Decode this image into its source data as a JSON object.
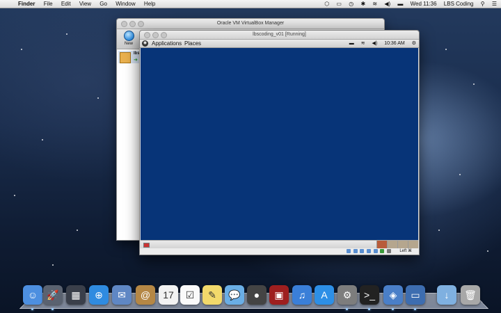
{
  "menubar": {
    "app_name": "Finder",
    "menus": [
      "File",
      "Edit",
      "View",
      "Go",
      "Window",
      "Help"
    ],
    "clock": "Wed 11:36",
    "user": "LBS Coding"
  },
  "vbox_manager": {
    "title": "Oracle VM VirtualBox Manager",
    "new_label": "New",
    "vm_name_partial": "lbs"
  },
  "vm_window": {
    "title": "lbscoding_v01 [Running]",
    "guest_panel": {
      "applications": "Applications",
      "places": "Places",
      "clock": "10:36 AM"
    },
    "guest_bg": "#073478",
    "host_key": "Left ⌘"
  },
  "dock": {
    "items": [
      {
        "name": "finder",
        "glyph": "☺",
        "color": "#4d8fe0"
      },
      {
        "name": "launchpad",
        "glyph": "🚀",
        "color": "#5a6270"
      },
      {
        "name": "mission-control",
        "glyph": "▦",
        "color": "#3a3f4a"
      },
      {
        "name": "safari",
        "glyph": "⊕",
        "color": "#2f8be0"
      },
      {
        "name": "mail",
        "glyph": "✉",
        "color": "#5f87c4"
      },
      {
        "name": "contacts",
        "glyph": "@",
        "color": "#b58745"
      },
      {
        "name": "calendar",
        "glyph": "17",
        "color": "#f2f2f2"
      },
      {
        "name": "reminders",
        "glyph": "☑",
        "color": "#fafafa"
      },
      {
        "name": "notes",
        "glyph": "✎",
        "color": "#f2d96b"
      },
      {
        "name": "messages",
        "glyph": "💬",
        "color": "#6aaee6"
      },
      {
        "name": "facetime",
        "glyph": "●",
        "color": "#444"
      },
      {
        "name": "photo-booth",
        "glyph": "▣",
        "color": "#9e1f1f"
      },
      {
        "name": "itunes",
        "glyph": "♫",
        "color": "#3a7fd8"
      },
      {
        "name": "app-store",
        "glyph": "A",
        "color": "#2d8fe6"
      },
      {
        "name": "system-preferences",
        "glyph": "⚙",
        "color": "#7d7d7d"
      },
      {
        "name": "terminal",
        "glyph": ">_",
        "color": "#222"
      },
      {
        "name": "virtualbox",
        "glyph": "◈",
        "color": "#4a7fc8"
      },
      {
        "name": "vm-display",
        "glyph": "▭",
        "color": "#3d6db0"
      },
      {
        "name": "downloads",
        "glyph": "↓",
        "color": "#7fb0e0"
      },
      {
        "name": "trash",
        "glyph": "🗑",
        "color": "#a8a8a8"
      }
    ]
  }
}
